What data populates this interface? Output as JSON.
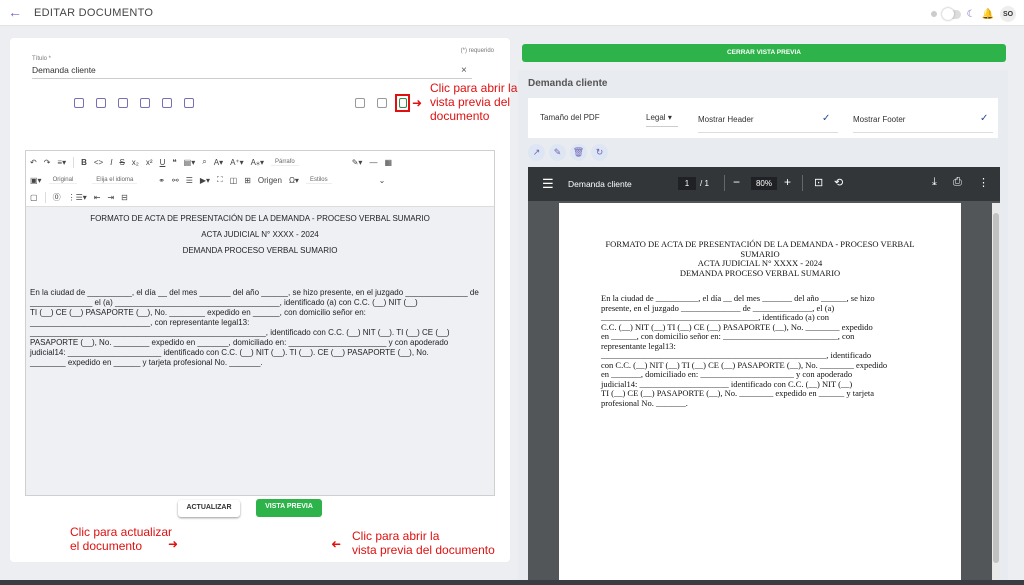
{
  "app": {
    "title": "EDITAR DOCUMENTO",
    "avatar": "SO"
  },
  "form": {
    "required_note": "(*) requerido",
    "title_label": "Título *",
    "title_value": "Demanda cliente"
  },
  "toolbar": {
    "language_placeholder": "Elija el idioma",
    "paragraph": "Párrafo",
    "original": "Original",
    "origin": "Origen",
    "styles": "Estilos"
  },
  "document": {
    "heading1": "FORMATO DE ACTA DE PRESENTACIÓN DE LA DEMANDA - PROCESO VERBAL SUMARIO",
    "heading2": "ACTA JUDICIAL N° XXXX - 2024",
    "heading3": "DEMANDA PROCESO VERBAL SUMARIO",
    "body_lines": [
      "En la ciudad de __________, el día __ del mes _______ del año ______, se hizo presente, en el juzgado ______________ de",
      "______________ el (a) _____________________________________, identificado (a) con C.C. (__) NIT (__)",
      " TI (__)  CE (__) PASAPORTE (__), No. ________ expedido en ______, con domicilio señor en:",
      "___________________________, con representante legal13:",
      "_____________________________________________________, identificado con C.C. (__) NIT (__). TI (__)  CE (__)",
      "PASAPORTE (__), No. ________ expedido en _______, domiciliado en: ______________________ y con apoderado",
      "judicial14: _____________________ identificado con C.C. (__) NIT (__). TI (__). CE (__) PASAPORTE (__), No.",
      "________ expedido en ______  y tarjeta profesional No. _______."
    ]
  },
  "actions": {
    "update": "ACTUALIZAR",
    "preview": "VISTA PREVIA",
    "close_preview": "CERRAR VISTA PREVIA"
  },
  "annotations": {
    "top": "Clic para abrir la\nvista previa del\ndocumento",
    "update": "Clic para actualizar\nel documento",
    "preview": "Clic para abrir la\nvista previa del documento"
  },
  "preview": {
    "title": "Demanda cliente",
    "pdf_size_label": "Tamaño del PDF",
    "pdf_size_value": "Legal",
    "show_header": "Mostrar Header",
    "show_footer": "Mostrar Footer"
  },
  "pdf": {
    "filename": "Demanda cliente",
    "page_current": "1",
    "page_total": "/  1",
    "zoom": "80%",
    "heading1": "FORMATO DE ACTA DE PRESENTACIÓN DE LA DEMANDA - PROCESO VERBAL SUMARIO",
    "heading2": "ACTA JUDICIAL N° XXXX - 2024",
    "heading3": "DEMANDA PROCESO VERBAL SUMARIO",
    "body_lines": [
      "En la ciudad de __________, el día __ del mes _______ del año ______, se hizo",
      "presente, en el juzgado ______________ de ______________, el (a)",
      "_____________________________________, identificado (a) con",
      "C.C. (__) NIT (__)  TI (__)  CE (__) PASAPORTE (__), No. ________ expedido",
      "en ______, con domicilio señor en: ___________________________, con",
      "representante legal13:",
      "_____________________________________________________, identificado",
      "con C.C. (__) NIT (__)  TI (__)  CE (__) PASAPORTE (__), No. ________ expedido",
      "en _______, domiciliado en: ______________________ y con apoderado",
      "judicial14: _____________________ identificado con C.C. (__) NIT (__)",
      " TI (__)  CE (__) PASAPORTE (__), No. ________ expedido en ______  y tarjeta",
      "profesional No. _______."
    ]
  }
}
